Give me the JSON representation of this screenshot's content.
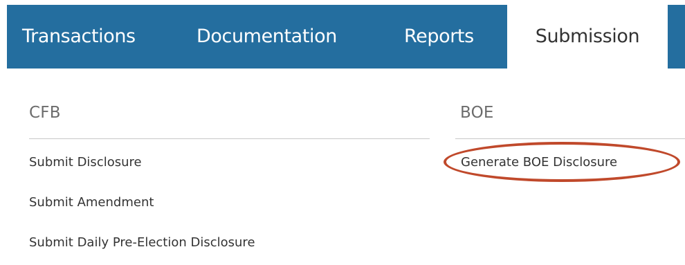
{
  "nav": {
    "tabs": [
      {
        "label": "Transactions"
      },
      {
        "label": "Documentation"
      },
      {
        "label": "Reports"
      },
      {
        "label": "Submission"
      }
    ],
    "active_tab": "Submission"
  },
  "sections": {
    "cfb": {
      "title": "CFB",
      "links": [
        {
          "label": "Submit Disclosure"
        },
        {
          "label": "Submit Amendment"
        },
        {
          "label": "Submit Daily Pre-Election Disclosure"
        }
      ]
    },
    "boe": {
      "title": "BOE",
      "links": [
        {
          "label": "Generate BOE Disclosure"
        }
      ]
    }
  },
  "colors": {
    "nav_background": "#246e9f",
    "nav_text": "#ffffff",
    "active_tab_text": "#333333",
    "annotation_circle": "#c0492b"
  }
}
